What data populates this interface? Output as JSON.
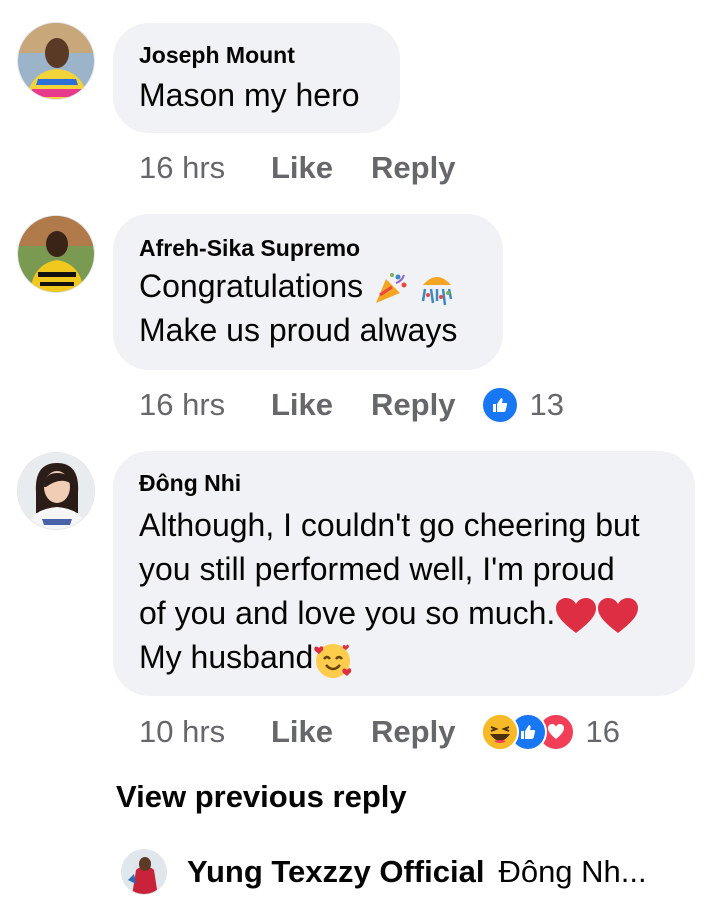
{
  "comments": [
    {
      "author": "Joseph Mount",
      "lines": [
        "Mason my hero"
      ],
      "time": "16 hrs",
      "like_label": "Like",
      "reply_label": "Reply",
      "reaction_count": null
    },
    {
      "author": "Afreh-Sika Supremo",
      "lines": [
        "Congratulations",
        "Make us proud always"
      ],
      "time": "16 hrs",
      "like_label": "Like",
      "reply_label": "Reply",
      "reaction_count": "13",
      "reactions": [
        "like-icon"
      ]
    },
    {
      "author": "Đông Nhi",
      "lines": [
        "Although, I couldn't go cheering but",
        "you still performed well, I'm proud",
        "of you and love you so much.",
        "My husband"
      ],
      "time": "10 hrs",
      "like_label": "Like",
      "reply_label": "Reply",
      "reaction_count": "16",
      "reactions": [
        "haha-icon",
        "like-icon",
        "love-icon"
      ]
    }
  ],
  "view_previous_label": "View previous reply",
  "last_reply": {
    "author": "Yung Texzzy Official",
    "preview": "Đông Nh..."
  },
  "colors": {
    "bubble": "#f0f2f5",
    "meta_text": "#65676b",
    "like_blue": "#1877f2",
    "love_red": "#f33e58",
    "haha_yellow": "#f7b928"
  }
}
